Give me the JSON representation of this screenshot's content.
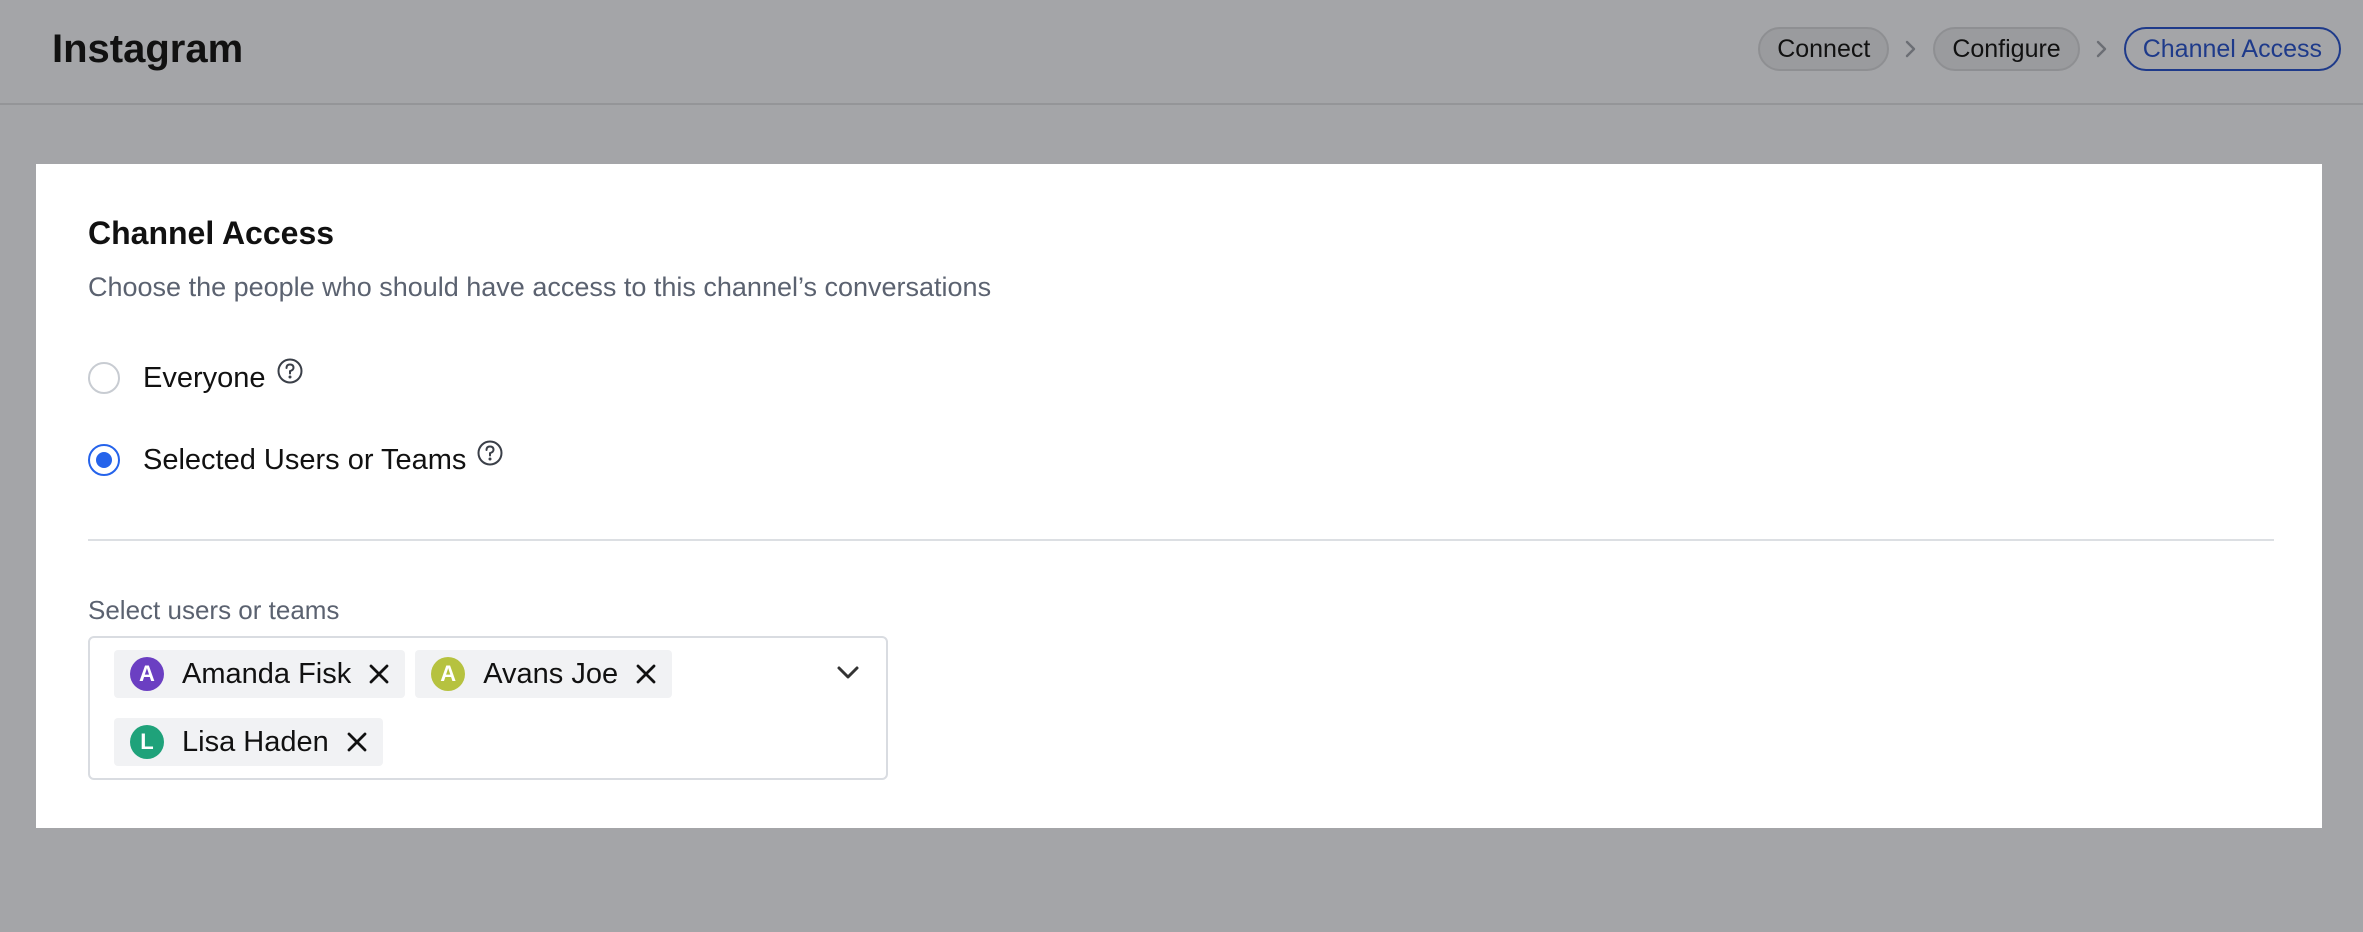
{
  "header": {
    "title": "Instagram",
    "steps": [
      {
        "label": "Connect"
      },
      {
        "label": "Configure"
      },
      {
        "label": "Channel Access"
      }
    ]
  },
  "card": {
    "title": "Channel Access",
    "description": "Choose the people who should have access to this channel’s conversations",
    "options": [
      {
        "label": "Everyone",
        "checked": false
      },
      {
        "label": "Selected Users or Teams",
        "checked": true
      }
    ],
    "select": {
      "label": "Select users or teams",
      "chips": [
        {
          "initial": "A",
          "name": "Amanda Fisk",
          "color": "#6b3fc2"
        },
        {
          "initial": "A",
          "name": "Avans Joe",
          "color": "#b6c23f"
        },
        {
          "initial": "L",
          "name": "Lisa Haden",
          "color": "#1fa27a"
        }
      ]
    }
  },
  "colors": {
    "accent": "#2563eb",
    "active_step": "#1e3a8a",
    "overlay_bg": "#a4a5a8"
  },
  "icons": {
    "help": "question-circle-icon",
    "step_separator": "chevron-right-icon",
    "dropdown": "chevron-down-icon",
    "remove": "close-icon"
  }
}
